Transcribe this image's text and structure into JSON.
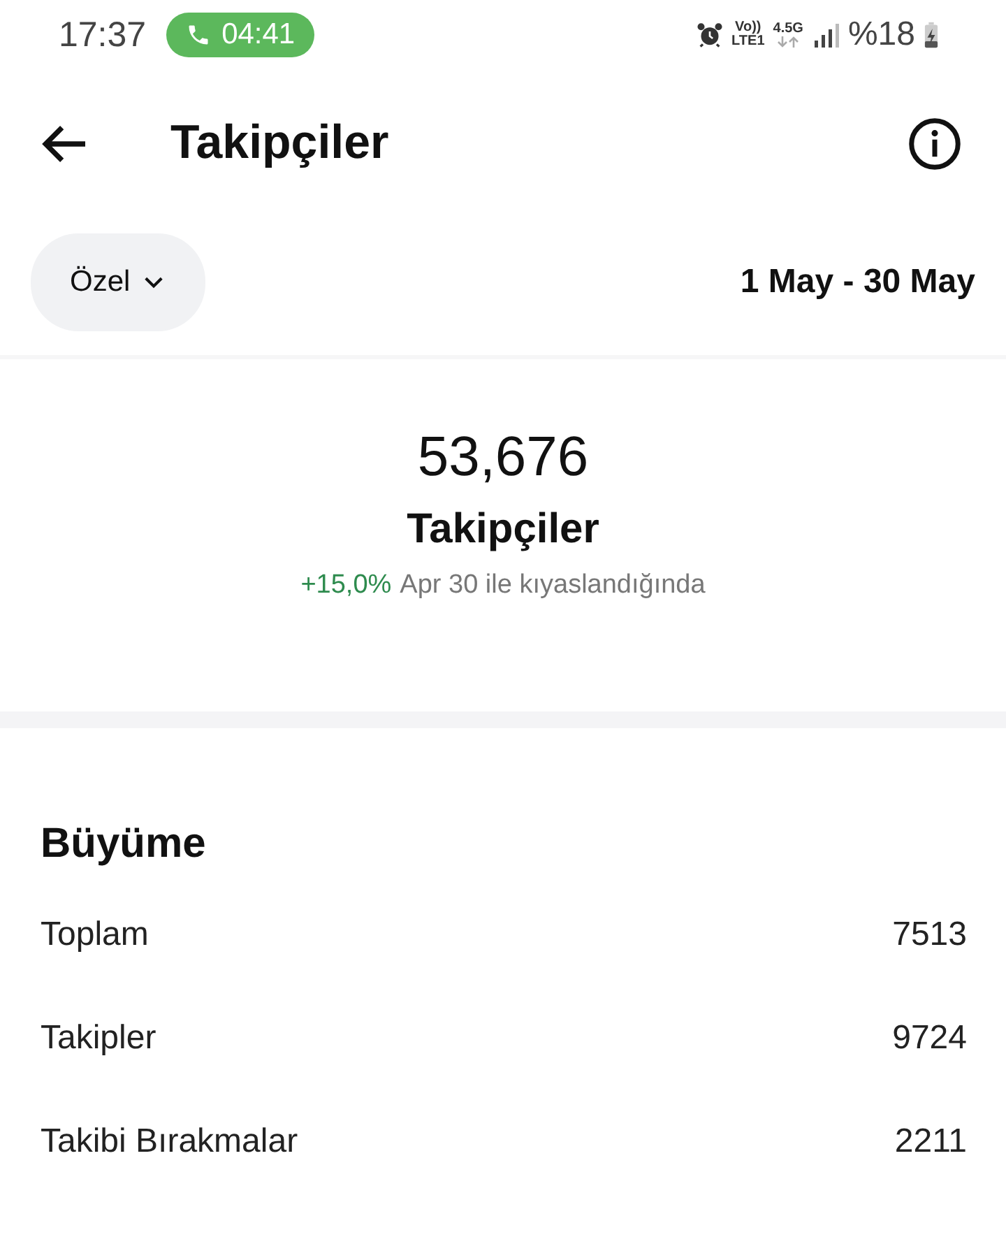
{
  "status_bar": {
    "time": "17:37",
    "call_timer": "04:41",
    "volte_top": "Vo))",
    "volte_bottom": "LTE1",
    "network_type": "4.5G",
    "battery": "%18"
  },
  "header": {
    "title": "Takipçiler"
  },
  "filter": {
    "label": "Özel",
    "date_range": "1 May - 30 May"
  },
  "summary": {
    "value": "53,676",
    "label": "Takipçiler",
    "change": "+15,0%",
    "comparison": "Apr 30 ile kıyaslandığında"
  },
  "growth": {
    "title": "Büyüme",
    "rows": [
      {
        "label": "Toplam",
        "value": "7513"
      },
      {
        "label": "Takipler",
        "value": "9724"
      },
      {
        "label": "Takibi Bırakmalar",
        "value": "2211"
      }
    ]
  }
}
